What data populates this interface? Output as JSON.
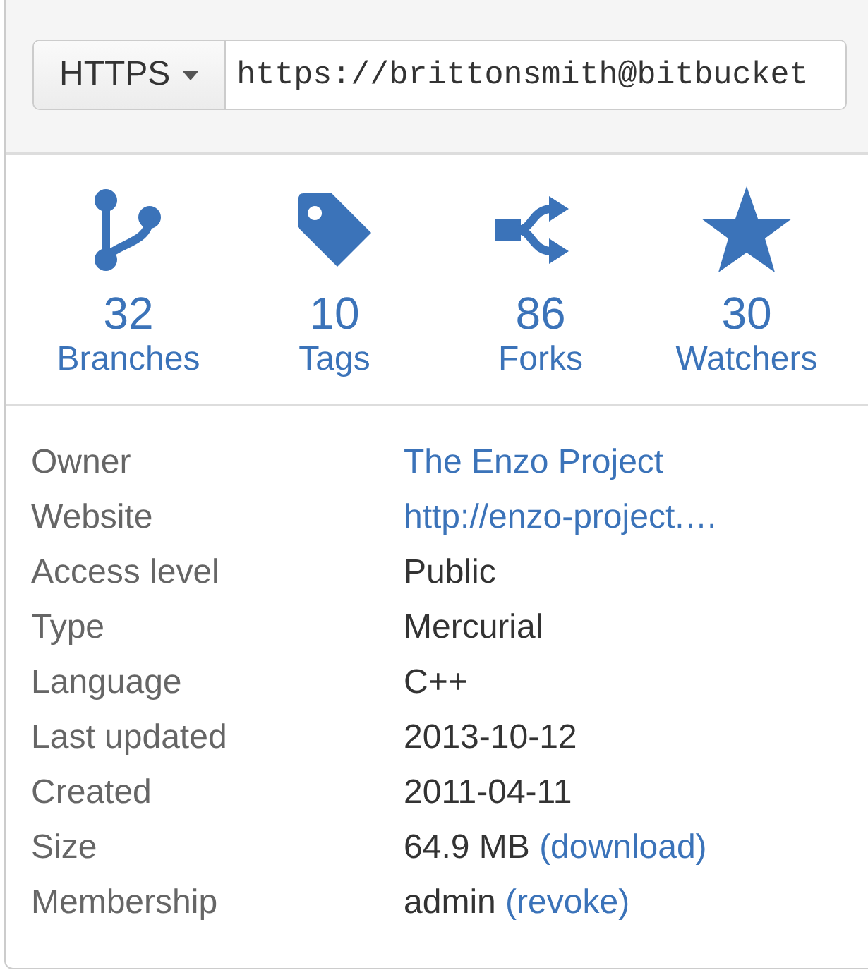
{
  "clone": {
    "protocol": "HTTPS",
    "url": "https://brittonsmith@bitbucket"
  },
  "stats": [
    {
      "kind": "branch",
      "count": "32",
      "label": "Branches"
    },
    {
      "kind": "tag",
      "count": "10",
      "label": "Tags"
    },
    {
      "kind": "fork",
      "count": "86",
      "label": "Forks"
    },
    {
      "kind": "star",
      "count": "30",
      "label": "Watchers"
    }
  ],
  "details": [
    {
      "label": "Owner",
      "value": [
        {
          "kind": "link",
          "text": "The Enzo Project"
        }
      ]
    },
    {
      "label": "Website",
      "value": [
        {
          "kind": "link",
          "text": "http://enzo-project.…"
        }
      ]
    },
    {
      "label": "Access level",
      "value": [
        {
          "kind": "text",
          "text": "Public"
        }
      ]
    },
    {
      "label": "Type",
      "value": [
        {
          "kind": "text",
          "text": "Mercurial"
        }
      ]
    },
    {
      "label": "Language",
      "value": [
        {
          "kind": "text",
          "text": "C++"
        }
      ]
    },
    {
      "label": "Last updated",
      "value": [
        {
          "kind": "text",
          "text": "2013-10-12"
        }
      ]
    },
    {
      "label": "Created",
      "value": [
        {
          "kind": "text",
          "text": "2011-04-11"
        }
      ]
    },
    {
      "label": "Size",
      "value": [
        {
          "kind": "text",
          "text": "64.9 MB"
        },
        {
          "kind": "link",
          "text": "(download)"
        }
      ]
    },
    {
      "label": "Membership",
      "value": [
        {
          "kind": "text",
          "text": "admin"
        },
        {
          "kind": "link",
          "text": "(revoke)"
        }
      ]
    }
  ]
}
